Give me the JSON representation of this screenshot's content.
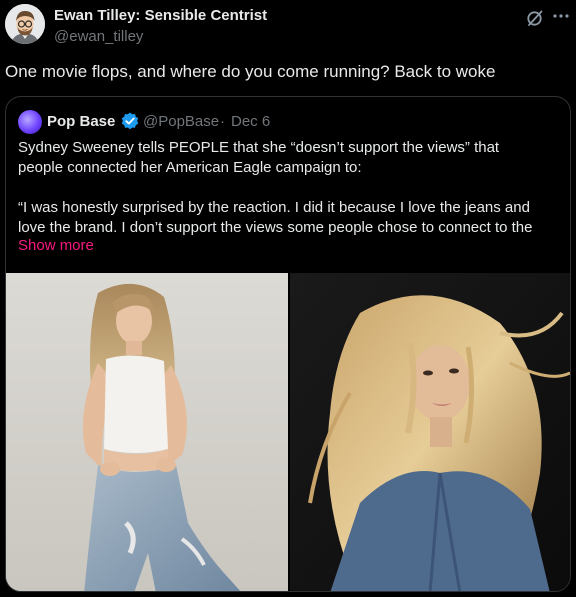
{
  "author": {
    "name": "Ewan Tilley: Sensible Centrist",
    "handle": "@ewan_tilley"
  },
  "tweet": {
    "text": "One movie flops, and where do you come running? Back to woke"
  },
  "quote": {
    "name": "Pop Base",
    "handle": "@PopBase",
    "separator": "·",
    "date": "Dec 6",
    "lines": [
      "Sydney Sweeney tells PEOPLE that she “doesn’t support the views” that",
      "people connected her American Eagle campaign to:",
      "“I was honestly surprised by the reaction. I did it because I love the jeans and",
      "love the brand. I don’t support the views some people chose to connect to the"
    ],
    "show_more": "Show more"
  },
  "icons": {
    "grok": "grok-icon",
    "more": "more-horizontal-icon",
    "verified": "verified-badge-icon"
  },
  "colors": {
    "background": "#000000",
    "text": "#e7e9ea",
    "muted": "#71767b",
    "border": "#2f3336",
    "link": "#f91880",
    "verified": "#1d9bf0"
  }
}
